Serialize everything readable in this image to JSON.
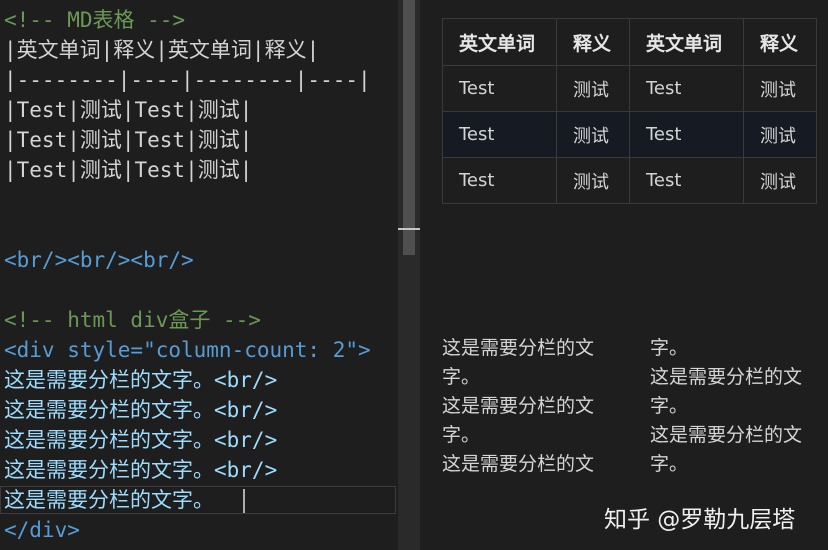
{
  "editor": {
    "lines": [
      {
        "text": "<!-- MD表格 -->",
        "kind": "comment"
      },
      {
        "text": "|英文单词|释义|英文单词|释义|",
        "kind": "text"
      },
      {
        "text": "|--------|----|--------|----|",
        "kind": "text"
      },
      {
        "text": "|Test|测试|Test|测试|",
        "kind": "text"
      },
      {
        "text": "|Test|测试|Test|测试|",
        "kind": "text"
      },
      {
        "text": "|Test|测试|Test|测试|",
        "kind": "text"
      },
      {
        "text": "<br/><br/><br/>",
        "kind": "tag"
      },
      {
        "text": "<!-- html div盒子 -->",
        "kind": "comment"
      },
      {
        "text": "<div style=\"column-count: 2\">",
        "kind": "tag"
      },
      {
        "text": "这是需要分栏的文字。<br/>",
        "kind": "body"
      },
      {
        "text": "这是需要分栏的文字。<br/>",
        "kind": "body"
      },
      {
        "text": "这是需要分栏的文字。<br/>",
        "kind": "body"
      },
      {
        "text": "这是需要分栏的文字。<br/>",
        "kind": "body"
      },
      {
        "text": "这是需要分栏的文字。",
        "kind": "body"
      },
      {
        "text": "</div>",
        "kind": "tag"
      }
    ]
  },
  "preview": {
    "table": {
      "headers": [
        "英文单词",
        "释义",
        "英文单词",
        "释义"
      ],
      "rows": [
        [
          "Test",
          "测试",
          "Test",
          "测试"
        ],
        [
          "Test",
          "测试",
          "Test",
          "测试"
        ],
        [
          "Test",
          "测试",
          "Test",
          "测试"
        ]
      ]
    },
    "columns": {
      "left": [
        "这是需要分栏的文",
        "字。",
        "这是需要分栏的文",
        "字。",
        "这是需要分栏的文"
      ],
      "right": [
        "字。",
        "这是需要分栏的文",
        "字。",
        "这是需要分栏的文",
        "字。"
      ]
    },
    "watermark": "知乎 @罗勒九层塔"
  }
}
